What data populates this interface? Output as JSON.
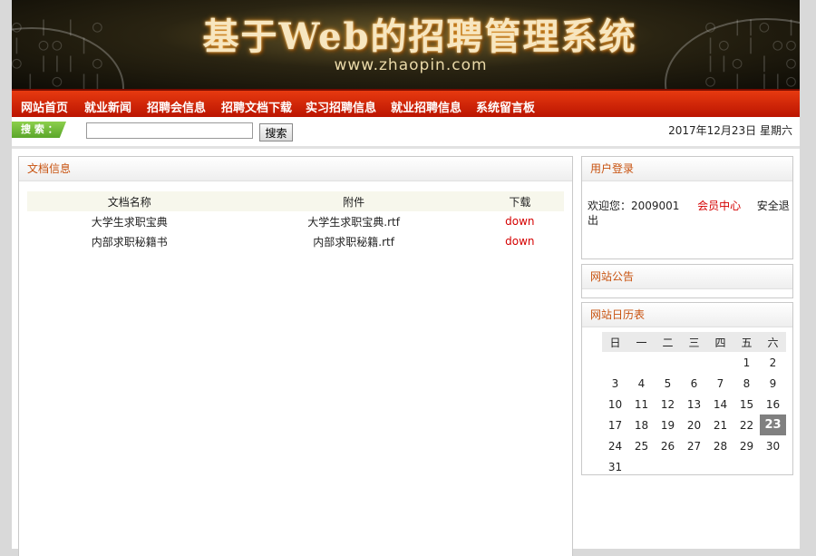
{
  "banner": {
    "title": "基于Web的招聘管理系统",
    "url": "www.zhaopin.com"
  },
  "nav": {
    "items": [
      "网站首页",
      "就业新闻",
      "招聘会信息",
      "招聘文档下载",
      "实习招聘信息",
      "就业招聘信息",
      "系统留言板"
    ]
  },
  "search": {
    "tag_label": "搜 索 ：",
    "input_value": "",
    "button_label": "搜索"
  },
  "date_text": "2017年12月23日 星期六",
  "main": {
    "title": "文档信息",
    "columns": [
      "文档名称",
      "附件",
      "下载"
    ],
    "rows": [
      [
        "大学生求职宝典",
        "大学生求职宝典.rtf",
        "down"
      ],
      [
        "内部求职秘籍书",
        "内部求职秘籍.rtf",
        "down"
      ]
    ]
  },
  "login": {
    "title": "用户登录",
    "welcome": "欢迎您：2009001",
    "member_center": "会员中心",
    "logout": "安全退出"
  },
  "notice": {
    "title": "网站公告"
  },
  "calendar": {
    "title": "网站日历表",
    "weekdays": [
      "日",
      "一",
      "二",
      "三",
      "四",
      "五",
      "六"
    ],
    "weeks": [
      [
        "",
        "",
        "",
        "",
        "",
        "1",
        "2"
      ],
      [
        "3",
        "4",
        "5",
        "6",
        "7",
        "8",
        "9"
      ],
      [
        "10",
        "11",
        "12",
        "13",
        "14",
        "15",
        "16"
      ],
      [
        "17",
        "18",
        "19",
        "20",
        "21",
        "22",
        "23"
      ],
      [
        "24",
        "25",
        "26",
        "27",
        "28",
        "29",
        "30"
      ],
      [
        "31",
        "",
        "",
        "",
        "",
        "",
        ""
      ]
    ],
    "today": "23"
  },
  "colors": {
    "nav_red": "#cc2000",
    "panel_title": "#c8520f",
    "link_red": "#d40000",
    "search_tag_green": "#6fbb38"
  }
}
